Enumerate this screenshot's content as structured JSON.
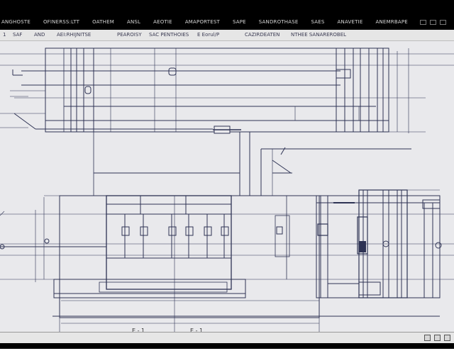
{
  "menu": {
    "items": [
      "ANGHOSTE",
      "OFINERSS:LTT",
      "OATHEM",
      "ANSL",
      "AEOTIE",
      "AMAPORTEST",
      "SAPE",
      "SANDROTHASE",
      "SAES",
      "ANAVETIE",
      "ANEMRBAPE"
    ]
  },
  "toolbar": {
    "labels": [
      "1",
      "SAF",
      "AND",
      "AEI:RHIJNITSE",
      "PEAROISY",
      "SAC PENTHOIES",
      "E Eorul/P",
      "CAZIRDEATEN",
      "NTHEE SANAREROBEL"
    ]
  },
  "drawing": {
    "dim_labels": [
      "E - 1",
      "E - 1"
    ]
  },
  "colors": {
    "canvas_bg": "#e9e9ec",
    "line_color": "#2e3354",
    "chrome_bg": "#e6e6e6"
  }
}
